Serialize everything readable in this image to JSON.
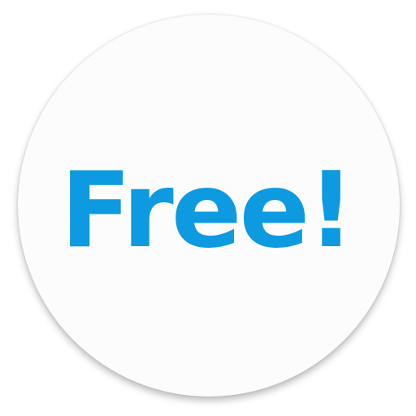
{
  "badge": {
    "label": "Free!",
    "text_color": "#0d9ae0",
    "background_color": "#fcfcfc"
  }
}
